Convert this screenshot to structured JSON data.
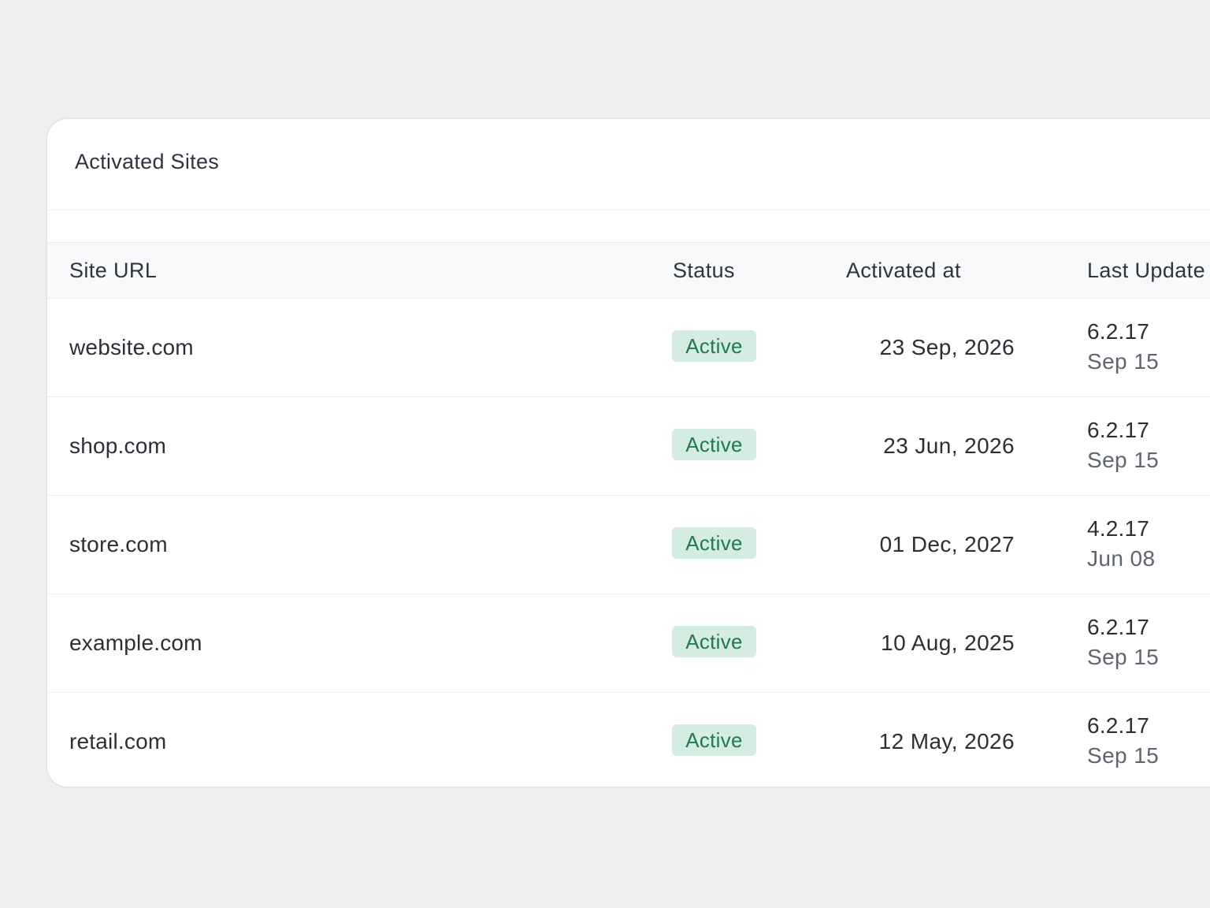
{
  "card": {
    "title": "Activated Sites"
  },
  "table": {
    "columns": {
      "site_url": "Site URL",
      "status": "Status",
      "activated_at": "Activated at",
      "last_update": "Last Update"
    },
    "rows": [
      {
        "site": "website.com",
        "status": "Active",
        "activated": "23 Sep, 2026",
        "version": "6.2.17",
        "updated": "Sep 15"
      },
      {
        "site": "shop.com",
        "status": "Active",
        "activated": "23 Jun, 2026",
        "version": "6.2.17",
        "updated": "Sep 15"
      },
      {
        "site": "store.com",
        "status": "Active",
        "activated": "01 Dec, 2027",
        "version": "4.2.17",
        "updated": "Jun 08"
      },
      {
        "site": "example.com",
        "status": "Active",
        "activated": "10 Aug, 2025",
        "version": "6.2.17",
        "updated": "Sep 15"
      },
      {
        "site": "retail.com",
        "status": "Active",
        "activated": "12 May, 2026",
        "version": "6.2.17",
        "updated": "Sep 15"
      }
    ]
  },
  "colors": {
    "page_background": "#eeeff1",
    "card_background": "#ffffff",
    "header_row_background": "#f8f9fb",
    "status_badge_background": "#d5ece2",
    "status_badge_text": "#1f7a4c"
  }
}
